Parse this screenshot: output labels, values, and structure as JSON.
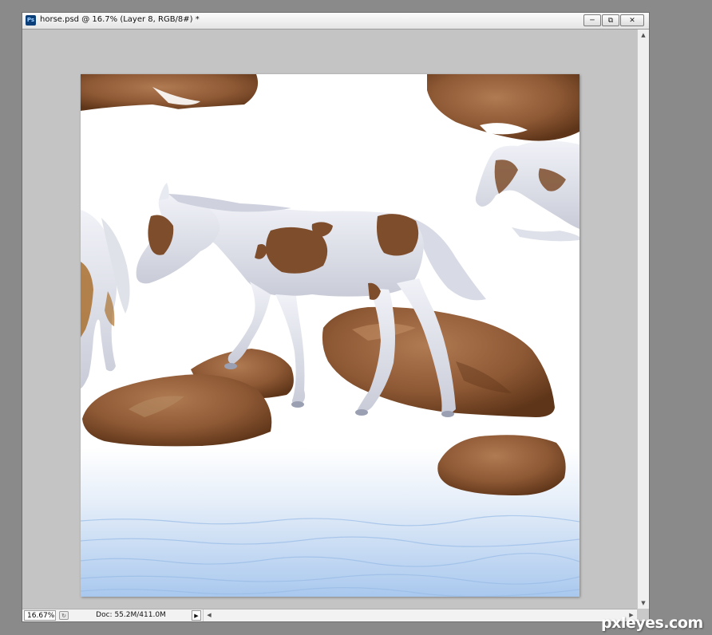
{
  "app": {
    "icon": "photoshop-icon",
    "icon_label": "Ps",
    "title": "horse.psd @ 16.7% (Layer 8, RGB/8#) *"
  },
  "window_controls": {
    "minimize": "minimize-icon",
    "restore": "restore-icon",
    "close": "close-icon"
  },
  "status": {
    "zoom": "16.67%",
    "doc_info": "Doc: 55.2M/411.0M"
  },
  "watermark": "pxleyes.com",
  "colors": {
    "rock": "#8b5a3a",
    "sky_water": "#c9dcf2",
    "horse_coat": "#e6e8f0",
    "patch": "#7e4d2c"
  }
}
